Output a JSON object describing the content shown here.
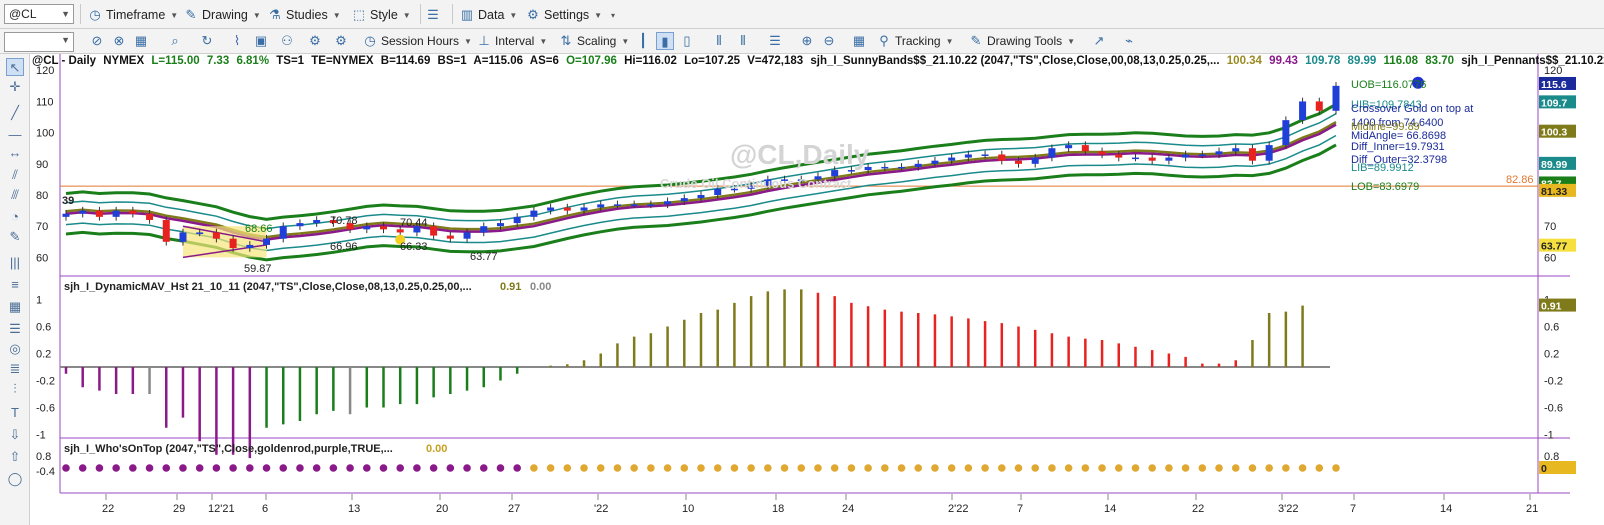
{
  "toolbar1": {
    "symbol": "@CL",
    "timeframe": "Timeframe",
    "drawing": "Drawing",
    "studies": "Studies",
    "style": "Style",
    "data": "Data",
    "settings": "Settings"
  },
  "toolbar2": {
    "session_hours": "Session Hours",
    "interval": "Interval",
    "scaling": "Scaling",
    "tracking": "Tracking",
    "drawing_tools": "Drawing Tools"
  },
  "header": {
    "symbol": "@CL - Daily",
    "exchange": "NYMEX",
    "last": "L=115.00",
    "chg": "7.33",
    "pct": "6.81%",
    "ts": "TS=1",
    "te": "TE=NYMEX",
    "bid": "B=114.69",
    "bs": "BS=1",
    "ask": "A=115.06",
    "as": "AS=6",
    "open": "O=107.96",
    "high": "Hi=116.02",
    "low": "Lo=107.25",
    "vol": "V=472,183",
    "study1": "sjh_I_SunnyBands$$_21.10.22 (2047,\"TS\",Close,Close,00,08,13,0.25,0.25,...",
    "v1": "100.34",
    "v2": "99.43",
    "v3": "109.78",
    "v4": "89.99",
    "v5": "116.08",
    "v6": "83.70",
    "study2": "sjh_I_Pennants$$_21.10.22 (2047,..."
  },
  "watermark": {
    "title": "@CL,Daily",
    "subtitle": "Crude Oil Continuous Contract"
  },
  "annotations": {
    "uob": "UOB=116.0776",
    "uib": "UIB=109.7843",
    "midline": "Midline=99.89",
    "crossover": "Crossover Gold on top at",
    "crossover2": "1400 from 74.6400",
    "midangle": "MidAngle= 66.8698",
    "diff_inner": "Diff_Inner=19.7931",
    "diff_outer": "Diff_Outer=32.3798",
    "lib": "LIB=89.9912",
    "lob": "LOB=83.6979",
    "p39": "39",
    "p6866": "68.66",
    "p7078": "70.78",
    "p7044": "70.44",
    "p6696": "66.96",
    "p6633": "66.33",
    "p5987": "59.87",
    "p6377": "63.77",
    "h8286": "82.86"
  },
  "right_tags": {
    "t1156": "115.6",
    "t1097": "109.7",
    "t1003": "100.3",
    "t8999": "89.99",
    "t837": "83.7",
    "t8133": "81.33",
    "t6377": "63.77",
    "t091": "0.91",
    "t0": "0"
  },
  "panel2": {
    "title": "sjh_I_DynamicMAV_Hst 21_10_11 (2047,\"TS\",Close,Close,08,13,0.25,0.25,00,...",
    "v1": "0.91",
    "v2": "0.00"
  },
  "panel3": {
    "title": "sjh_I_Who'sOnTop (2047,\"TS\",Close,goldenrod,purple,TRUE,...",
    "v1": "0.00"
  },
  "axes": {
    "price_ticks": [
      "120",
      "110",
      "100",
      "90",
      "80",
      "70",
      "60"
    ],
    "right_price_ticks": [
      "120",
      "110",
      "70",
      "60"
    ],
    "osc_ticks": [
      "1",
      "0.6",
      "0.2",
      "-0.2",
      "-0.6",
      "-1"
    ],
    "wot_ticks": [
      "0.8",
      "-0.4"
    ],
    "right_osc_ticks": [
      "1",
      "0.6",
      "0.2",
      "-0.2",
      "-0.6",
      "-1"
    ],
    "right_wot_ticks": [
      "0.8"
    ],
    "dates": [
      "22",
      "29",
      "12'21",
      "6",
      "13",
      "20",
      "27",
      "'22",
      "10",
      "18",
      "24",
      "2'22",
      "7",
      "14",
      "22",
      "3'22",
      "7",
      "14",
      "21"
    ]
  },
  "colors": {
    "up": "#1f3fd8",
    "down": "#e8231f",
    "green": "#1a7f1a",
    "purple": "#8a1a8a",
    "gold": "#9a8a20",
    "teal": "#1a8a8a",
    "olive": "#7f7a1a",
    "orange": "#e07830"
  },
  "chart_data": {
    "type": "candlestick",
    "title": "@CL,Daily",
    "subtitle": "Crude Oil Continuous Contract",
    "ylim": [
      55,
      122
    ],
    "close": [
      74,
      75,
      73,
      75,
      74,
      72,
      65,
      68,
      68,
      66,
      63,
      64,
      66,
      70,
      71,
      72,
      71,
      69,
      70,
      69,
      68,
      70,
      67,
      66,
      68,
      70,
      71,
      73,
      75,
      76,
      75,
      76,
      77,
      77,
      77,
      77,
      78,
      79,
      80,
      82,
      82,
      83,
      85,
      85,
      85,
      86,
      88,
      88,
      89,
      89,
      89,
      90,
      91,
      92,
      93,
      93,
      91,
      90,
      92,
      95,
      96,
      94,
      93,
      92,
      92,
      91,
      92,
      93,
      93,
      94,
      95,
      91,
      96,
      104,
      110,
      107,
      115
    ],
    "osc_values": [
      -0.1,
      -0.3,
      -0.35,
      -0.4,
      -0.4,
      -0.4,
      -0.9,
      -0.75,
      -1.1,
      -1.3,
      -1.3,
      -1.35,
      -0.9,
      -0.85,
      -0.8,
      -0.7,
      -0.65,
      -0.7,
      -0.6,
      -0.6,
      -0.55,
      -0.55,
      -0.45,
      -0.4,
      -0.35,
      -0.3,
      -0.2,
      -0.1,
      0,
      0.02,
      0.04,
      0.1,
      0.2,
      0.35,
      0.45,
      0.5,
      0.6,
      0.7,
      0.8,
      0.85,
      0.95,
      1.05,
      1.12,
      1.15,
      1.15,
      1.1,
      1.05,
      0.95,
      0.9,
      0.85,
      0.82,
      0.8,
      0.78,
      0.75,
      0.72,
      0.68,
      0.65,
      0.6,
      0.55,
      0.5,
      0.45,
      0.42,
      0.4,
      0.35,
      0.3,
      0.25,
      0.2,
      0.15,
      0.05,
      0.05,
      0.1,
      0.4,
      0.8,
      0.82,
      0.91
    ]
  }
}
